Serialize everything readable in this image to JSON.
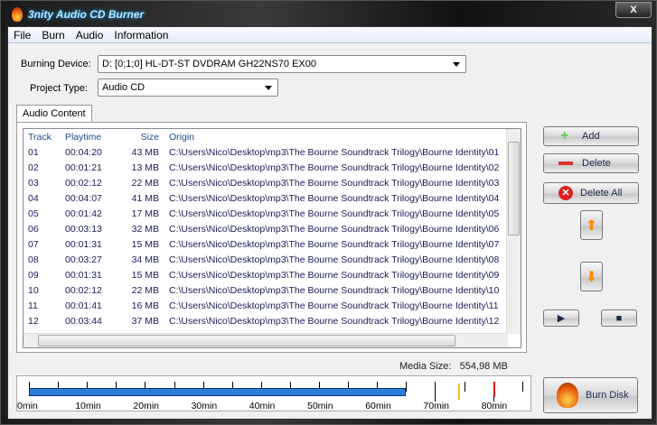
{
  "window": {
    "title": "3nity Audio CD Burner",
    "close_label": "X"
  },
  "menu": [
    "File",
    "Burn",
    "Audio",
    "Information"
  ],
  "burning_device": {
    "label": "Burning Device:",
    "value": "D:  [0;1;0] HL-DT-ST DVDRAM GH22NS70  EX00"
  },
  "project_type": {
    "label": "Project Type:",
    "value": "Audio CD"
  },
  "tab": "Audio Content",
  "columns": [
    "Track",
    "Playtime",
    "Size",
    "Origin"
  ],
  "rows": [
    [
      "01",
      "00:04:20",
      "43 MB",
      "C:\\Users\\Nico\\Desktop\\mp3\\The Bourne Soundtrack Trilogy\\Bourne Identity\\01"
    ],
    [
      "02",
      "00:01:21",
      "13 MB",
      "C:\\Users\\Nico\\Desktop\\mp3\\The Bourne Soundtrack Trilogy\\Bourne Identity\\02"
    ],
    [
      "03",
      "00:02:12",
      "22 MB",
      "C:\\Users\\Nico\\Desktop\\mp3\\The Bourne Soundtrack Trilogy\\Bourne Identity\\03"
    ],
    [
      "04",
      "00:04:07",
      "41 MB",
      "C:\\Users\\Nico\\Desktop\\mp3\\The Bourne Soundtrack Trilogy\\Bourne Identity\\04"
    ],
    [
      "05",
      "00:01:42",
      "17 MB",
      "C:\\Users\\Nico\\Desktop\\mp3\\The Bourne Soundtrack Trilogy\\Bourne Identity\\05"
    ],
    [
      "06",
      "00:03:13",
      "32 MB",
      "C:\\Users\\Nico\\Desktop\\mp3\\The Bourne Soundtrack Trilogy\\Bourne Identity\\06"
    ],
    [
      "07",
      "00:01:31",
      "15 MB",
      "C:\\Users\\Nico\\Desktop\\mp3\\The Bourne Soundtrack Trilogy\\Bourne Identity\\07"
    ],
    [
      "08",
      "00:03:27",
      "34 MB",
      "C:\\Users\\Nico\\Desktop\\mp3\\The Bourne Soundtrack Trilogy\\Bourne Identity\\08"
    ],
    [
      "09",
      "00:01:31",
      "15 MB",
      "C:\\Users\\Nico\\Desktop\\mp3\\The Bourne Soundtrack Trilogy\\Bourne Identity\\09"
    ],
    [
      "10",
      "00:02:12",
      "22 MB",
      "C:\\Users\\Nico\\Desktop\\mp3\\The Bourne Soundtrack Trilogy\\Bourne Identity\\10"
    ],
    [
      "11",
      "00:01:41",
      "16 MB",
      "C:\\Users\\Nico\\Desktop\\mp3\\The Bourne Soundtrack Trilogy\\Bourne Identity\\11"
    ],
    [
      "12",
      "00:03:44",
      "37 MB",
      "C:\\Users\\Nico\\Desktop\\mp3\\The Bourne Soundtrack Trilogy\\Bourne Identity\\12"
    ]
  ],
  "buttons": {
    "add": "Add",
    "delete": "Delete",
    "delete_all": "Delete All",
    "burn": "Burn Disk"
  },
  "media_size": {
    "label": "Media Size:",
    "value": "554,98 MB"
  },
  "timeline": {
    "ticks": [
      "0min",
      "10min",
      "20min",
      "30min",
      "40min",
      "50min",
      "60min",
      "70min",
      "80min"
    ],
    "filled_minutes": 65,
    "yellow_marker_minutes": 74,
    "red_marker_minutes": 80,
    "fill_color": "#2a7fd8",
    "yellow": "#f0c020",
    "red": "#d01010"
  }
}
